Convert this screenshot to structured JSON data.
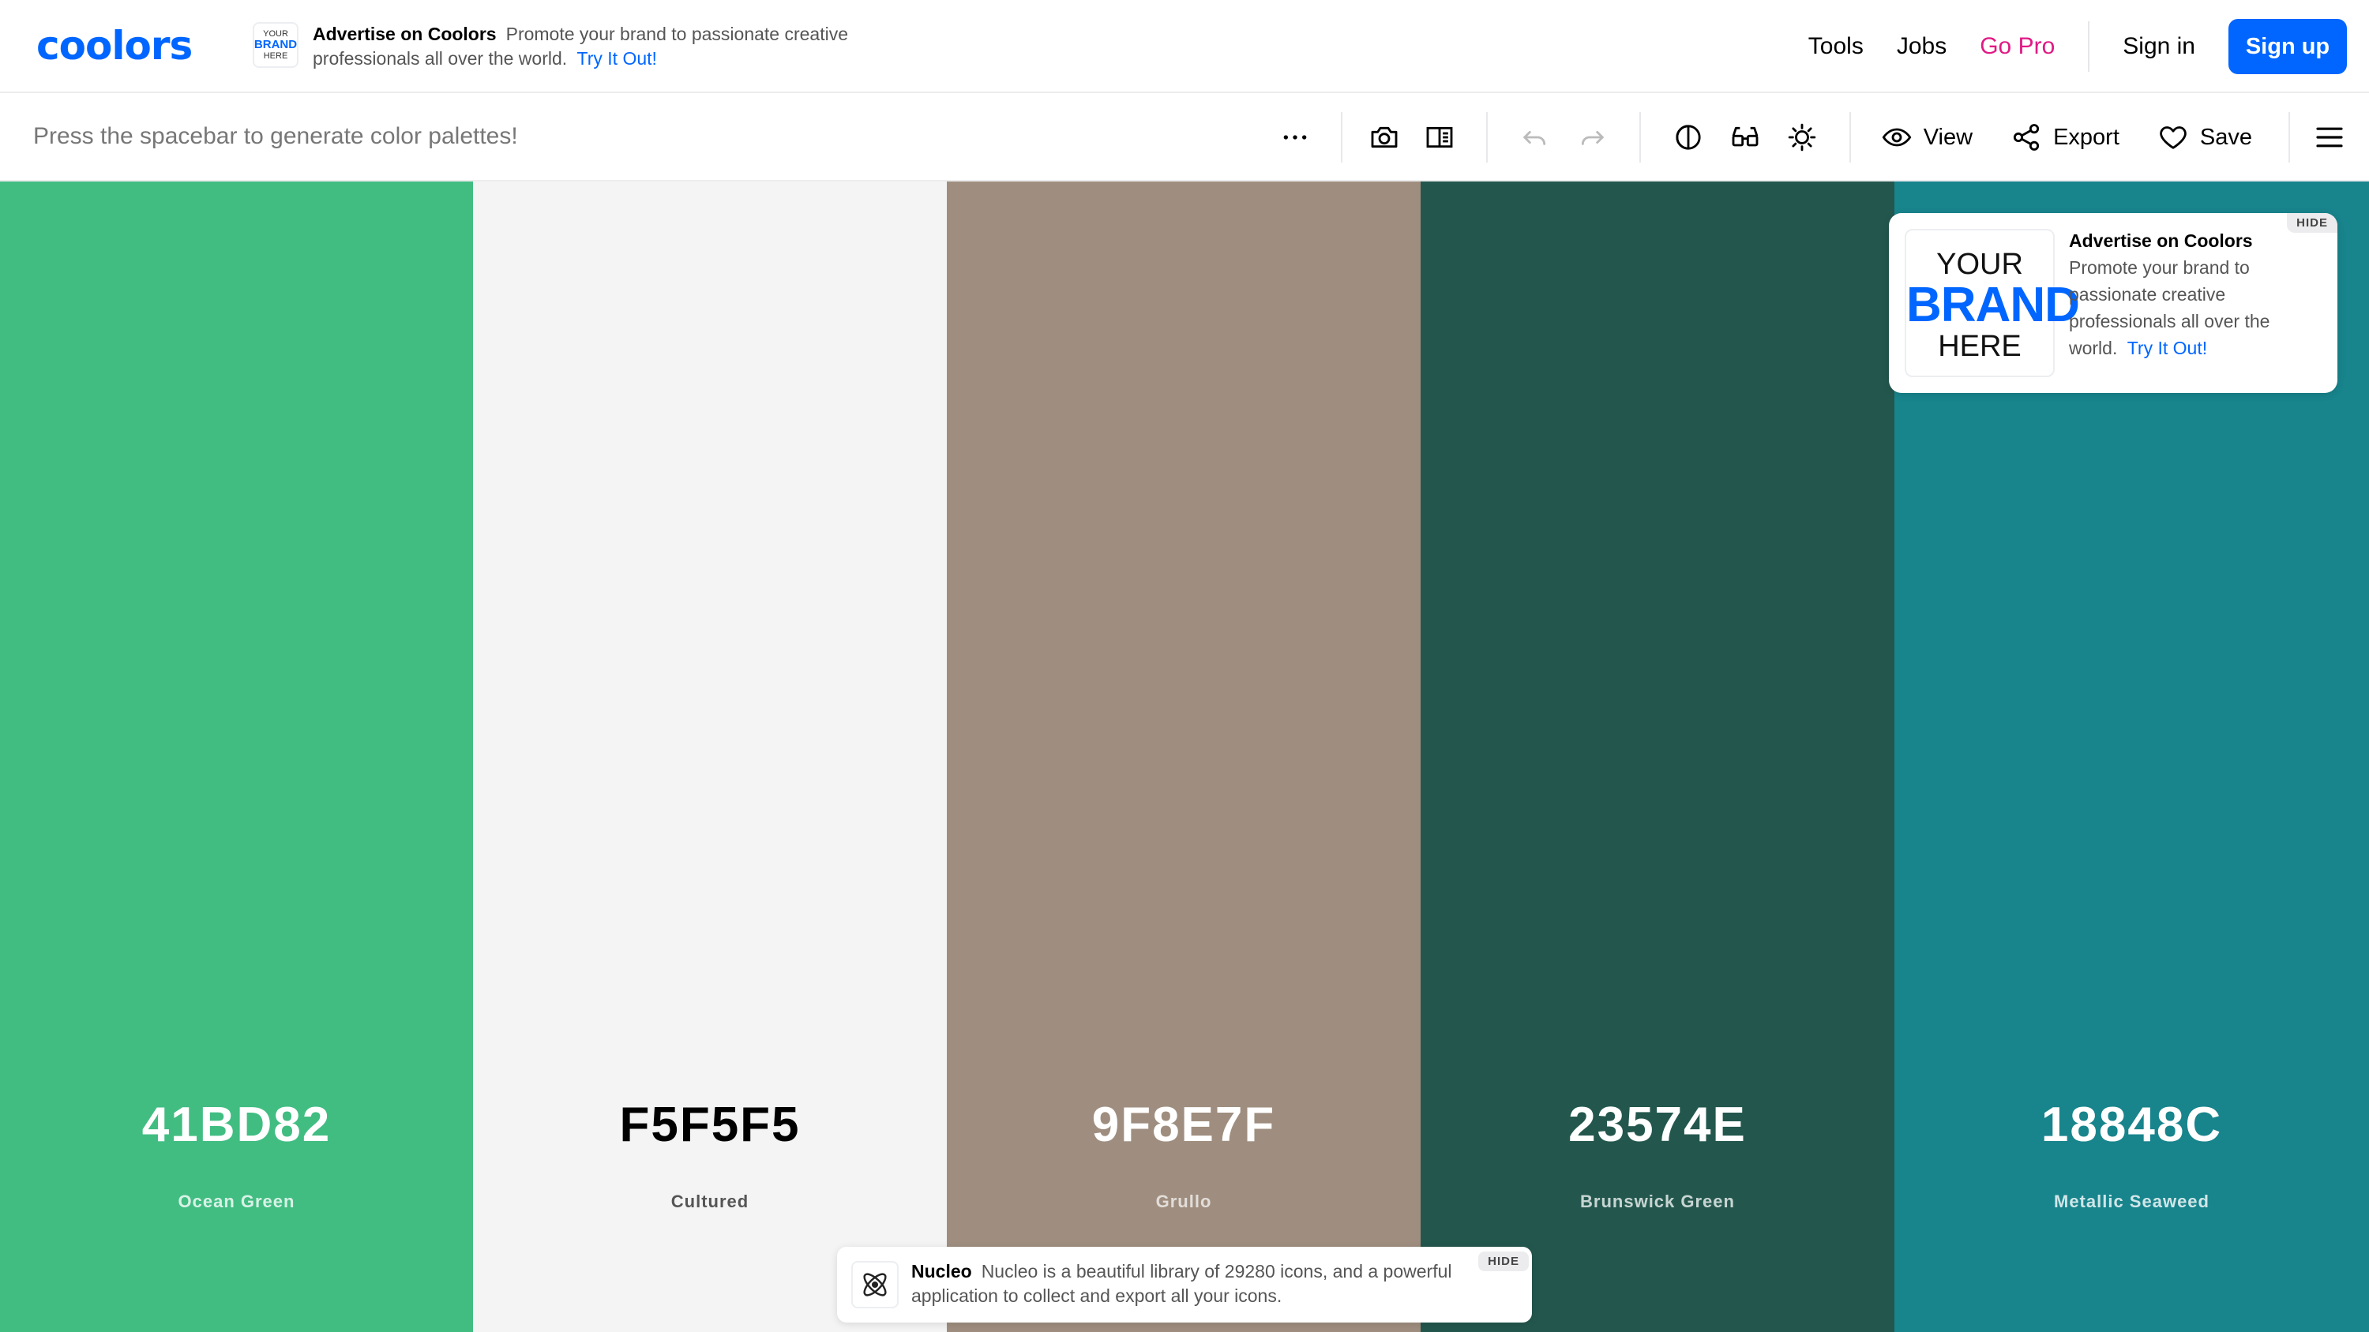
{
  "header": {
    "logo": "coolors",
    "ad": {
      "thumb_line1": "YOUR",
      "thumb_line2": "BRAND",
      "thumb_line3": "HERE",
      "title": "Advertise on Coolors",
      "text": "Promote your brand to passionate creative professionals all over the world.",
      "cta": "Try It Out!"
    },
    "nav": {
      "tools": "Tools",
      "jobs": "Jobs",
      "go_pro": "Go Pro",
      "sign_in": "Sign in",
      "sign_up": "Sign up"
    },
    "colors": {
      "accent": "#0066ff",
      "pro": "#e01a84"
    }
  },
  "toolbar": {
    "hint": "Press the spacebar to generate color palettes!",
    "view_label": "View",
    "export_label": "Export",
    "save_label": "Save",
    "icons": [
      "more-options-icon",
      "camera-icon",
      "split-view-icon",
      "undo-icon",
      "redo-icon",
      "contrast-icon",
      "glasses-icon",
      "brightness-icon",
      "eye-icon",
      "share-icon",
      "heart-icon",
      "menu-icon"
    ]
  },
  "palette": {
    "colors": [
      {
        "hex": "41BD82",
        "name": "Ocean Green",
        "bg": "#41bd82",
        "text": "#ffffff",
        "sub": "rgba(255,255,255,0.8)"
      },
      {
        "hex": "F5F5F5",
        "name": "Cultured",
        "bg": "#f4f4f4",
        "text": "#000000",
        "sub": "#555555"
      },
      {
        "hex": "9F8E7F",
        "name": "Grullo",
        "bg": "#9f8e7f",
        "text": "#ffffff",
        "sub": "rgba(255,255,255,0.7)"
      },
      {
        "hex": "23574E",
        "name": "Brunswick Green",
        "bg": "#23574e",
        "text": "#ffffff",
        "sub": "rgba(255,255,255,0.75)"
      },
      {
        "hex": "18848C",
        "name": "Metallic Seaweed",
        "bg": "#18848c",
        "text": "#ffffff",
        "sub": "rgba(255,255,255,0.8)"
      }
    ]
  },
  "side_ad": {
    "brand_line1": "YOUR",
    "brand_line2": "BRAND",
    "brand_line3": "HERE",
    "title": "Advertise on Coolors",
    "text": "Promote your brand to passionate creative professionals all over the world.",
    "cta": "Try It Out!",
    "hide": "HIDE"
  },
  "bottom_ad": {
    "title": "Nucleo",
    "text": "Nucleo is a beautiful library of 29280 icons, and a powerful application to collect and export all your icons.",
    "hide": "HIDE"
  }
}
